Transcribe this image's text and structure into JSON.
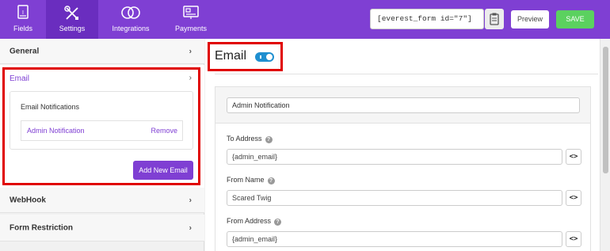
{
  "nav": {
    "fields": "Fields",
    "settings": "Settings",
    "integrations": "Integrations",
    "payments": "Payments"
  },
  "toolbar": {
    "shortcode": "[everest_form id=\"7\"]",
    "preview": "Preview",
    "save": "SAVE"
  },
  "sidebar": {
    "general": "General",
    "email": "Email",
    "email_notifications_title": "Email Notifications",
    "notification_name": "Admin Notification",
    "remove": "Remove",
    "add_new_email": "Add New Email",
    "webhook": "WebHook",
    "form_restriction": "Form Restriction",
    "chevron": "›"
  },
  "main": {
    "title": "Email",
    "toggle_on": true,
    "notification_name_value": "Admin Notification",
    "fields": [
      {
        "label": "To Address",
        "value": "{admin_email}"
      },
      {
        "label": "From Name",
        "value": "Scared Twig"
      },
      {
        "label": "From Address",
        "value": "{admin_email}"
      }
    ],
    "help": "?",
    "smart_tag": "<>"
  },
  "colors": {
    "accent": "#7f3fd3",
    "save": "#5bd15f",
    "toggle": "#1f8fd0",
    "highlight": "#e00000"
  }
}
